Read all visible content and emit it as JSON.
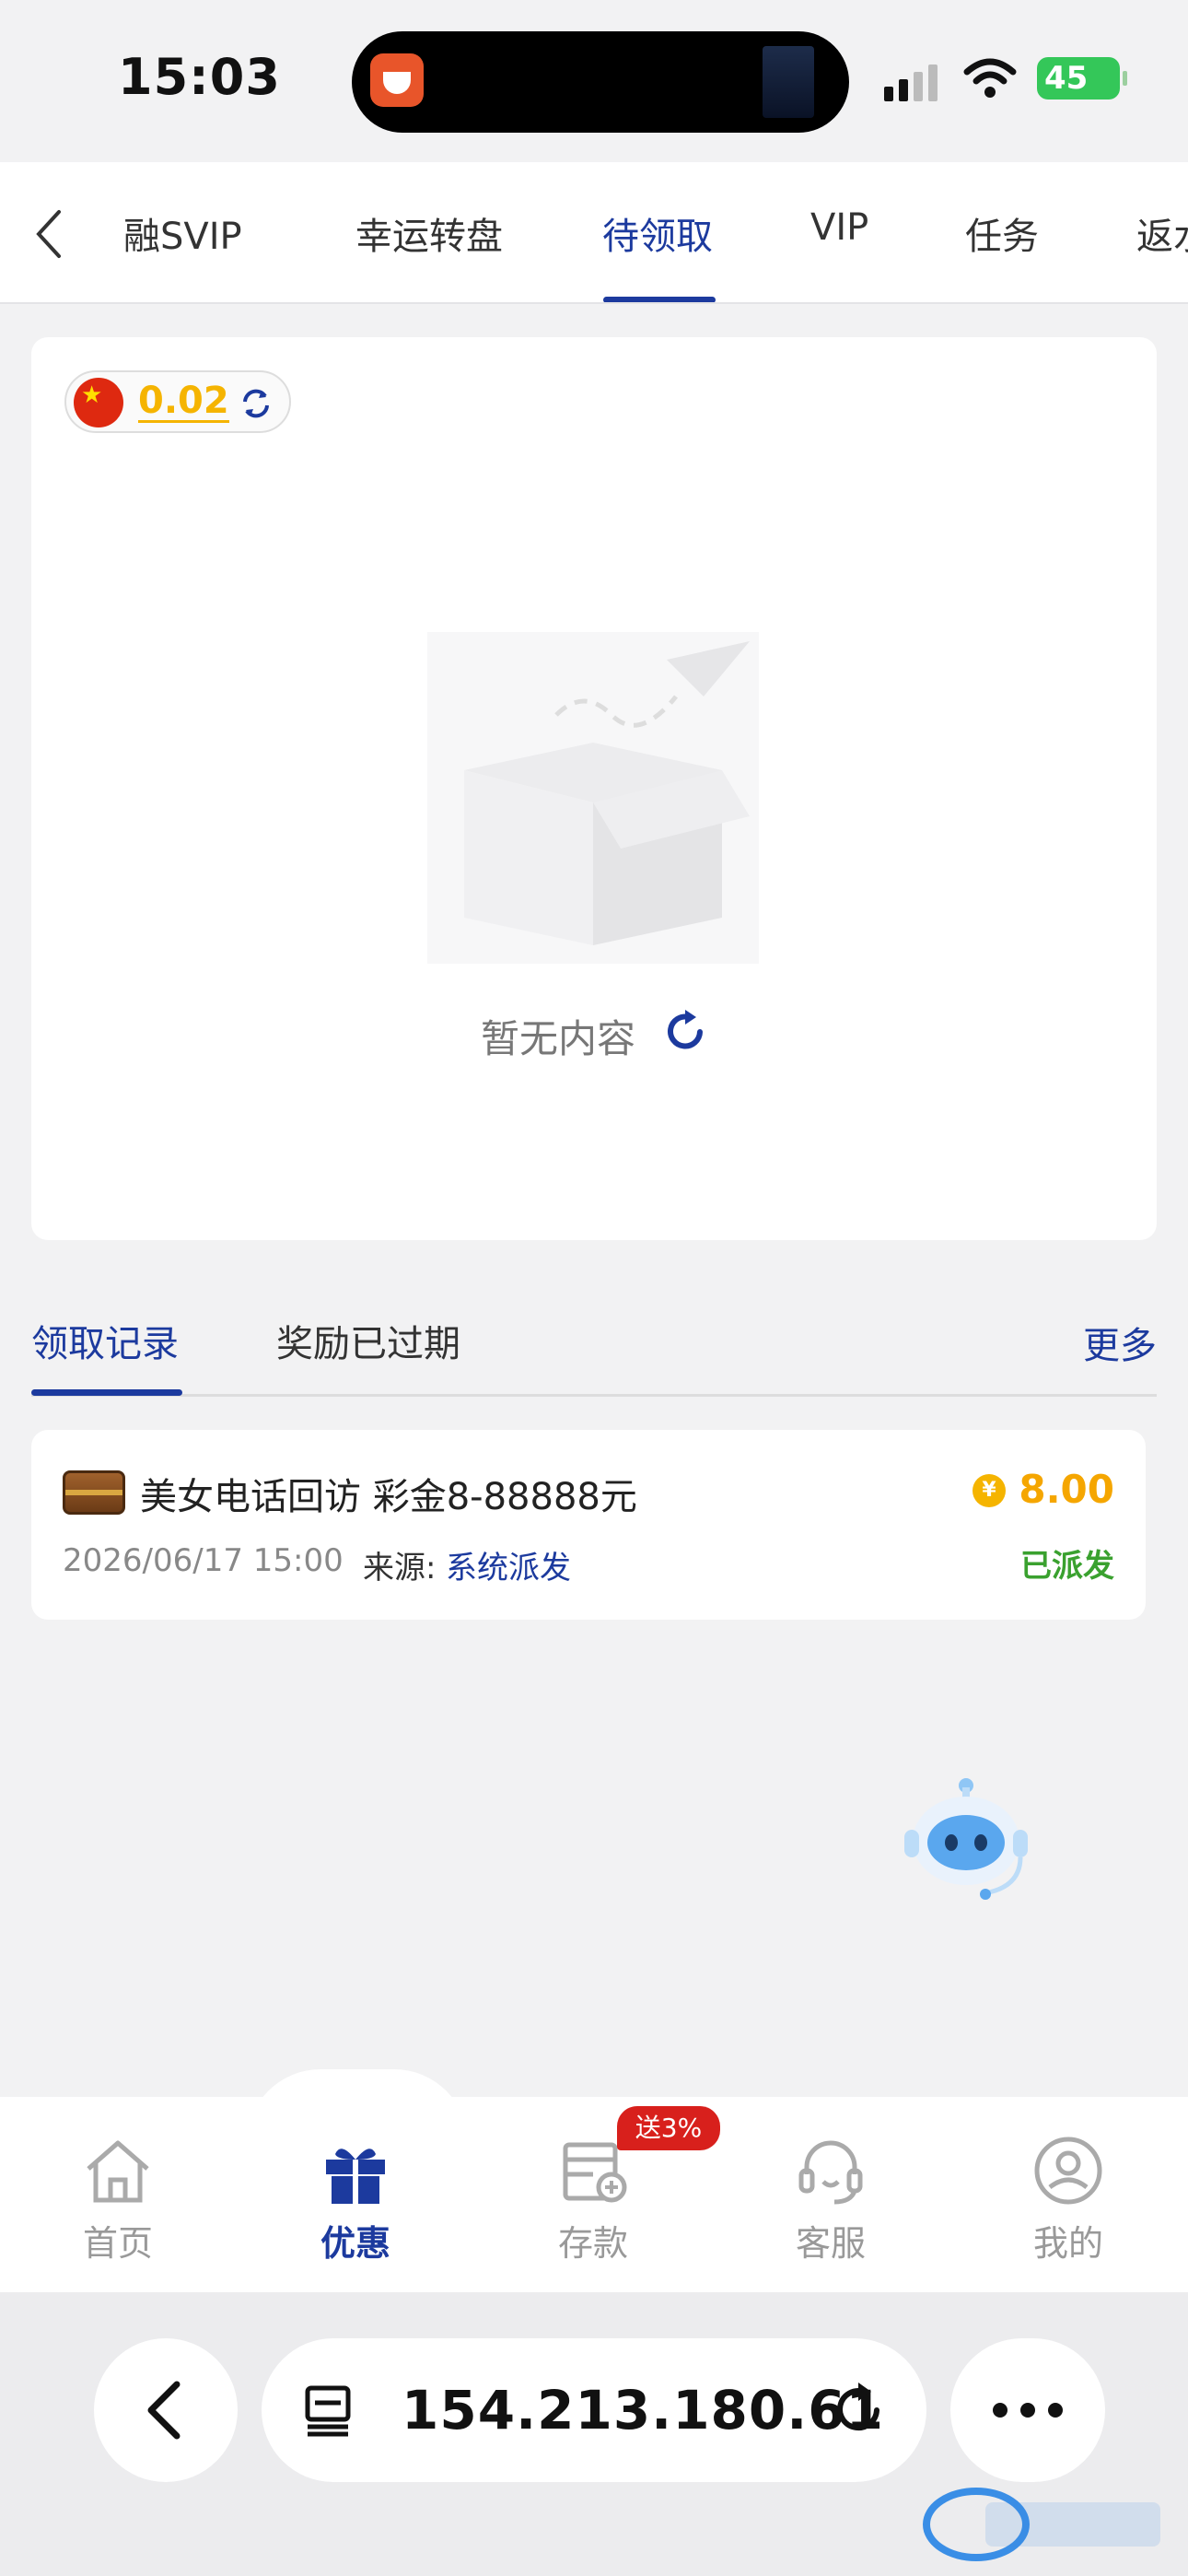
{
  "status_bar": {
    "time": "15:03",
    "battery": "45"
  },
  "tabs": [
    {
      "label": "金融SVIP",
      "display": "融SVIP"
    },
    {
      "label": "幸运转盘"
    },
    {
      "label": "待领取",
      "active": true
    },
    {
      "label": "VIP"
    },
    {
      "label": "任务"
    },
    {
      "label": "返水",
      "display": "返水"
    }
  ],
  "balance": {
    "value": "0.02",
    "flag": "china-flag"
  },
  "empty_state": {
    "text": "暂无内容"
  },
  "records": {
    "tabs": [
      "领取记录",
      "奖励已过期"
    ],
    "more": "更多",
    "items": [
      {
        "title": "美女电话回访 彩金8-88888元",
        "amount": "8.00",
        "date": "2026/06/17 15:00",
        "source_label": "来源:",
        "source": "系统派发",
        "status": "已派发",
        "currency_symbol": "¥"
      }
    ]
  },
  "bottom_nav": {
    "items": [
      {
        "label": "首页",
        "icon": "home-icon"
      },
      {
        "label": "优惠",
        "icon": "gift-icon",
        "active": true
      },
      {
        "label": "存款",
        "icon": "deposit-icon"
      },
      {
        "label": "客服",
        "icon": "headset-icon"
      },
      {
        "label": "我的",
        "icon": "user-icon"
      }
    ],
    "deposit_badge": "送3%"
  },
  "browser": {
    "url": "154.213.180.61"
  },
  "colors": {
    "accent": "#1c3a9e",
    "gold": "#f5b400",
    "success": "#3aa12f",
    "badge": "#d8201c"
  }
}
